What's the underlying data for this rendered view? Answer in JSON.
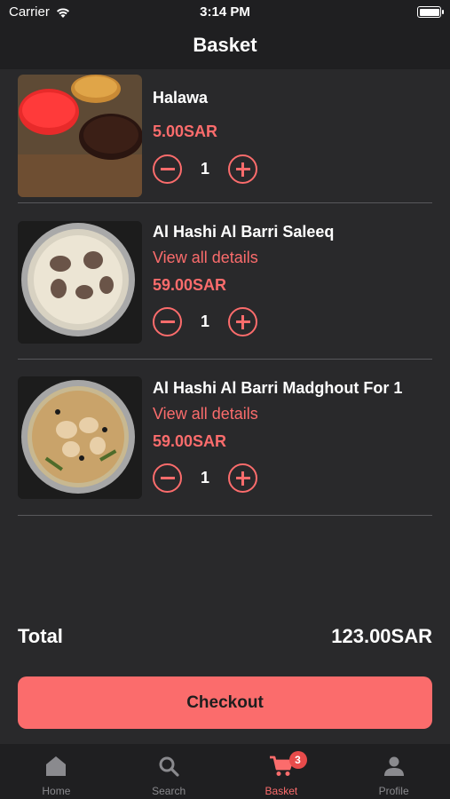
{
  "status_bar": {
    "carrier": "Carrier",
    "time": "3:14 PM"
  },
  "header": {
    "title": "Basket"
  },
  "items": [
    {
      "name": "Halawa",
      "details_link": "",
      "price": "5.00SAR",
      "quantity": "1"
    },
    {
      "name": "Al Hashi Al Barri Saleeq",
      "details_link": "View all details",
      "price": "59.00SAR",
      "quantity": "1"
    },
    {
      "name": "Al Hashi Al Barri Madghout For 1",
      "details_link": "View all details",
      "price": "59.00SAR",
      "quantity": "1"
    }
  ],
  "summary": {
    "total_label": "Total",
    "total_value": "123.00SAR"
  },
  "checkout": {
    "label": "Checkout"
  },
  "tabbar": {
    "tabs": [
      {
        "label": "Home",
        "icon": "home-icon"
      },
      {
        "label": "Search",
        "icon": "search-icon"
      },
      {
        "label": "Basket",
        "icon": "cart-icon",
        "badge": "3",
        "active": true
      },
      {
        "label": "Profile",
        "icon": "person-icon"
      }
    ]
  },
  "colors": {
    "accent": "#fb6c6c",
    "background": "#29292b",
    "bar": "#1f1f21",
    "badge": "#e84b4b"
  }
}
